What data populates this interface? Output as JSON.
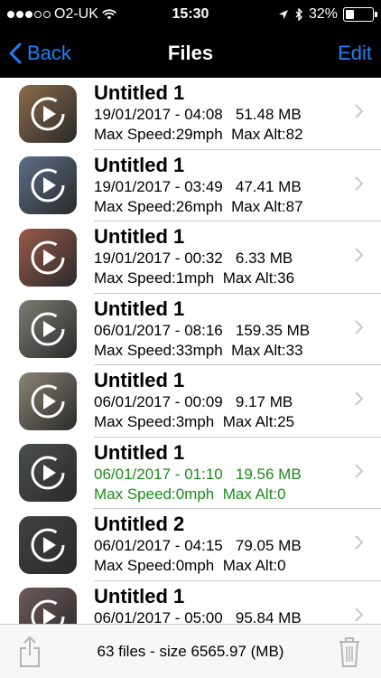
{
  "status": {
    "carrier": "O2-UK",
    "time": "15:30",
    "battery": "32%",
    "battery_level": 0.32
  },
  "nav": {
    "back_label": "Back",
    "title": "Files",
    "edit_label": "Edit"
  },
  "files": [
    {
      "title": "Untitled 1",
      "datetime_size": "19/01/2017 - 04:08   51.48 MB",
      "stats": "Max Speed:29mph  Max Alt:82",
      "thumb_color": "#8a6b4a"
    },
    {
      "title": "Untitled 1",
      "datetime_size": "19/01/2017 - 03:49   47.41 MB",
      "stats": "Max Speed:26mph  Max Alt:87",
      "thumb_color": "#5d6e86"
    },
    {
      "title": "Untitled 1",
      "datetime_size": "19/01/2017 - 00:32   6.33 MB",
      "stats": "Max Speed:1mph  Max Alt:36",
      "thumb_color": "#9a5a4a"
    },
    {
      "title": "Untitled 1",
      "datetime_size": "06/01/2017 - 08:16   159.35 MB",
      "stats": "Max Speed:33mph  Max Alt:33",
      "thumb_color": "#7d7c73"
    },
    {
      "title": "Untitled 1",
      "datetime_size": "06/01/2017 - 00:09   9.17 MB",
      "stats": "Max Speed:3mph  Max Alt:25",
      "thumb_color": "#8c8475"
    },
    {
      "title": "Untitled 1",
      "datetime_size": "06/01/2017 - 01:10   19.56 MB",
      "stats": "Max Speed:0mph  Max Alt:0",
      "thumb_color": "#4a4f4a",
      "highlight": true
    },
    {
      "title": "Untitled 2",
      "datetime_size": "06/01/2017 - 04:15   79.05 MB",
      "stats": "Max Speed:0mph  Max Alt:0",
      "thumb_color": "#3f4240"
    },
    {
      "title": "Untitled 1",
      "datetime_size": "06/01/2017 - 05:00   95.84 MB",
      "stats": "",
      "thumb_color": "#6e5a5a"
    }
  ],
  "footer": {
    "summary": "63 files - size 6565.97 (MB)"
  },
  "colors": {
    "accent": "#1a82f7",
    "highlight_text": "#1a8c1a"
  }
}
